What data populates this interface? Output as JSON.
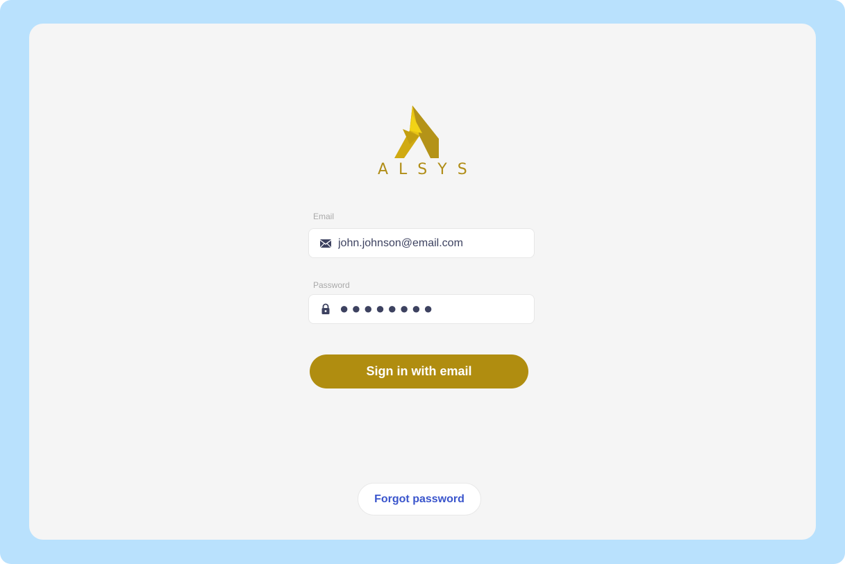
{
  "brand": {
    "logo_text": "ALSYS",
    "logo_icon": "alsys-logo-icon",
    "color": "#b08d17"
  },
  "form": {
    "email": {
      "label": "Email",
      "value": "john.johnson@email.com",
      "icon": "envelope-icon"
    },
    "password": {
      "label": "Password",
      "masked_value": "●●●●●●●●",
      "icon": "lock-icon"
    },
    "submit_label": "Sign in with email",
    "forgot_label": "Forgot password"
  },
  "colors": {
    "background": "#b9e1fd",
    "card": "#f5f5f5",
    "primary": "#b08d10",
    "link": "#3a55cc"
  }
}
